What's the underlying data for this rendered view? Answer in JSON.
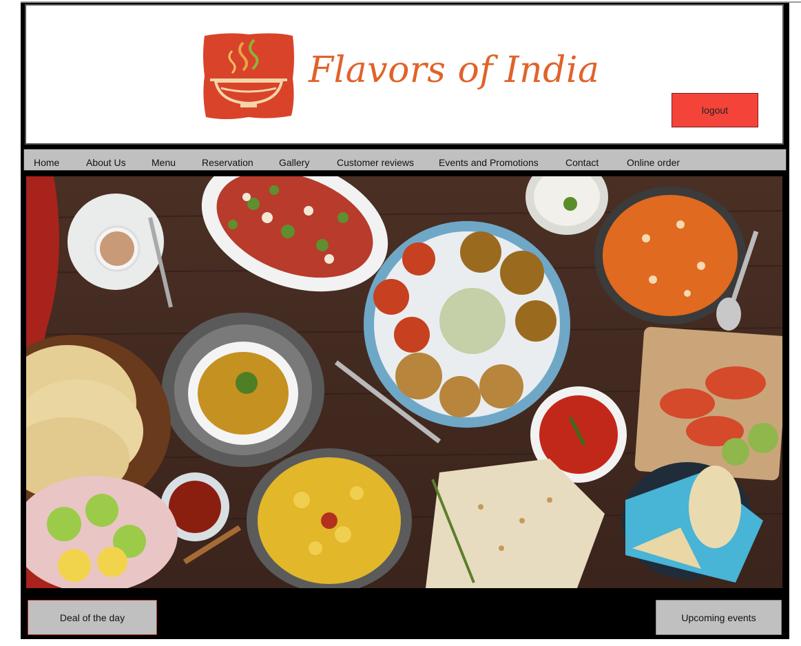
{
  "brand": {
    "name": "Flavors of India",
    "logo_icon": "steaming-bowl-icon",
    "logo_color": "#d9432a",
    "text_color": "#e0632a"
  },
  "header": {
    "logout_label": "logout",
    "logout_color": "#f4443a"
  },
  "nav": {
    "items": [
      {
        "label": "Home"
      },
      {
        "label": "About Us"
      },
      {
        "label": "Menu"
      },
      {
        "label": "Reservation"
      },
      {
        "label": "Gallery"
      },
      {
        "label": "Customer reviews"
      },
      {
        "label": "Events and Promotions"
      },
      {
        "label": "Contact"
      },
      {
        "label": "Online order"
      }
    ]
  },
  "hero": {
    "image": "indian-food-spread"
  },
  "footer": {
    "deal_label": "Deal of the day",
    "events_label": "Upcoming events"
  }
}
